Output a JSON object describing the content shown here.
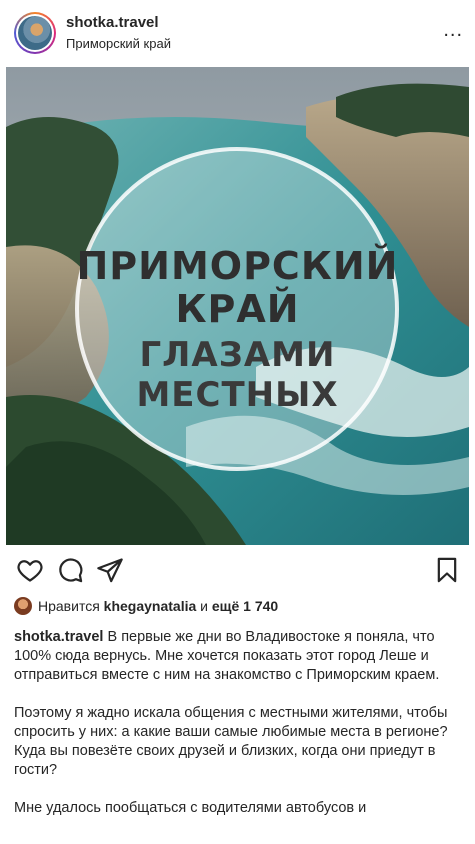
{
  "post": {
    "username": "shotka.travel",
    "location": "Приморский край",
    "more_label": "...",
    "image_text": {
      "line1": "ПРИМОРСКИЙ",
      "line2": "КРАЙ",
      "line3": "ГЛАЗАМИ",
      "line4": "МЕСТНЫХ"
    },
    "likes": {
      "prefix": "Нравится ",
      "user": "khegaynatalia",
      "middle": " и ",
      "rest": "ещё 1 740"
    },
    "caption": {
      "author": "shotka.travel",
      "p1": " В первые же дни во Владивостоке я поняла, что 100% сюда вернусь. Мне хочется показать этот город Леше и отправиться вместе с ним на знакомство с Приморским краем.",
      "p2": "Поэтому я жадно искала общения с местными жителями, чтобы спросить у них: а какие ваши самые любимые места в регионе? Куда вы повезёте своих друзей и близких, когда они приедут в гости?",
      "p3": "Мне удалось пообщаться с водителями автобусов и"
    }
  },
  "icons": {
    "like": "heart-icon",
    "comment": "comment-icon",
    "share": "paper-plane-icon",
    "save": "bookmark-icon"
  }
}
